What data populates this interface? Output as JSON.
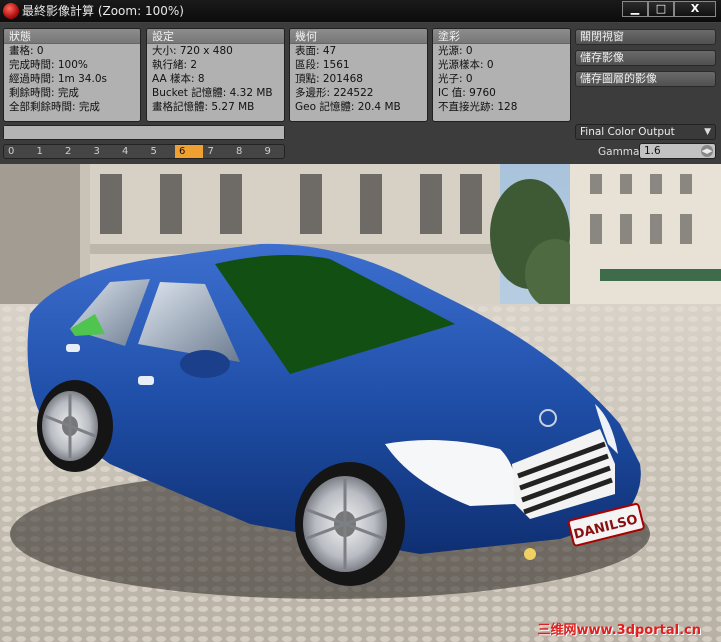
{
  "window": {
    "title": "最終影像計算 (Zoom: 100%)",
    "buttons": {
      "minimize": "▁",
      "maximize": "□",
      "close": "X"
    }
  },
  "status": {
    "header": "狀態",
    "lines": [
      "畫格: 0",
      "完成時間: 100%",
      "經過時間: 1m 34.0s",
      "剩餘時間: 完成",
      "全部剩餘時間: 完成"
    ]
  },
  "settings": {
    "header": "設定",
    "lines": [
      "大小: 720 x 480",
      "執行緒: 2",
      "AA 樣本: 8",
      "Bucket 記憶體: 4.32 MB",
      "畫格記憶體: 5.27 MB"
    ]
  },
  "geometry": {
    "header": "幾何",
    "lines": [
      "表面: 47",
      "區段: 1561",
      "頂點: 201468",
      "多邊形: 224522",
      "Geo 記憶體: 20.4 MB"
    ]
  },
  "shading": {
    "header": "塗彩",
    "lines": [
      "光源: 0",
      "光源樣本: 0",
      "光子: 0",
      "IC 值: 9760",
      "不直接光跡: 128"
    ]
  },
  "actions": {
    "close_view": "關閉視窗",
    "save_image": "儲存影像",
    "save_layered": "儲存圖層的影像"
  },
  "progress_fraction": 1.0,
  "slots": {
    "items": [
      "0",
      "1",
      "2",
      "3",
      "4",
      "5",
      "6",
      "7",
      "8",
      "9"
    ],
    "active_index": 6
  },
  "output": {
    "mode": "Final Color Output",
    "gamma_label": "Gamma",
    "gamma_value": "1.6"
  },
  "render": {
    "plate_text": "DANILSO",
    "watermark": "三维网www.3dportal.cn"
  },
  "colors": {
    "car_body": "#1f4fa8",
    "active_slot": "#f0a030",
    "watermark": "#e02020"
  }
}
